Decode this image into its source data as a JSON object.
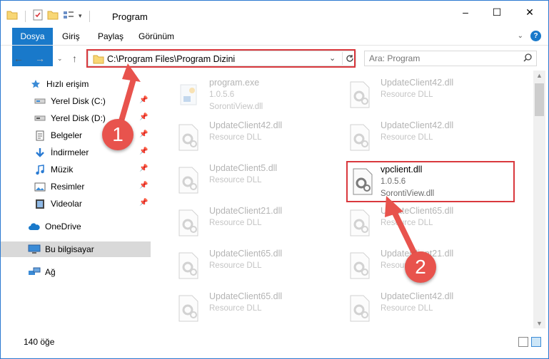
{
  "window": {
    "title": "Program",
    "controls": {
      "minimize": "–",
      "maximize": "☐",
      "close": "✕"
    }
  },
  "ribbon": {
    "tabs": [
      {
        "label": "Dosya"
      },
      {
        "label": "Giriş"
      },
      {
        "label": "Paylaş"
      },
      {
        "label": "Görünüm"
      }
    ],
    "help_icon": "?"
  },
  "address": {
    "path": "C:\\Program Files\\Program Dizini",
    "search_placeholder": "Ara: Program"
  },
  "nav": {
    "items": [
      {
        "label": "Hızlı erişim",
        "icon": "star-icon"
      },
      {
        "label": "Yerel Disk (C:)",
        "icon": "drive-icon",
        "pinned": true
      },
      {
        "label": "Yerel Disk (D:)",
        "icon": "drive-icon",
        "pinned": true
      },
      {
        "label": "Belgeler",
        "icon": "documents-icon",
        "pinned": true
      },
      {
        "label": "İndirmeler",
        "icon": "download-icon",
        "pinned": true
      },
      {
        "label": "Müzik",
        "icon": "music-icon",
        "pinned": true
      },
      {
        "label": "Resimler",
        "icon": "pictures-icon",
        "pinned": true
      },
      {
        "label": "Videolar",
        "icon": "videos-icon",
        "pinned": true
      },
      {
        "label": "OneDrive",
        "icon": "cloud-icon"
      },
      {
        "label": "Bu bilgisayar",
        "icon": "computer-icon",
        "selected": true
      },
      {
        "label": "Ağ",
        "icon": "network-icon"
      }
    ]
  },
  "files": [
    {
      "name": "program.exe",
      "l2": "1.0.5.6",
      "l3": "SorontiView.dll"
    },
    {
      "name": "UpdateClient42.dll",
      "l2": "Resource DLL",
      "l3": ""
    },
    {
      "name": "UpdateClient42.dll",
      "l2": "Resource DLL",
      "l3": ""
    },
    {
      "name": "UpdateClient42.dll",
      "l2": "Resource DLL",
      "l3": ""
    },
    {
      "name": "UpdateClient5.dll",
      "l2": "Resource DLL",
      "l3": ""
    },
    {
      "name": "vpclient.dll",
      "l2": "1.0.5.6",
      "l3": "SorontiView.dll"
    },
    {
      "name": "UpdateClient21.dll",
      "l2": "Resource DLL",
      "l3": ""
    },
    {
      "name": "UpdateClient65.dll",
      "l2": "Resource DLL",
      "l3": ""
    },
    {
      "name": "UpdateClient65.dll",
      "l2": "Resource DLL",
      "l3": ""
    },
    {
      "name": "UpdateClient21.dll",
      "l2": "Resource DLL",
      "l3": ""
    },
    {
      "name": "UpdateClient65.dll",
      "l2": "Resource DLL",
      "l3": ""
    },
    {
      "name": "UpdateClient42.dll",
      "l2": "Resource DLL",
      "l3": ""
    }
  ],
  "status": {
    "count": "140 öğe"
  },
  "annotations": {
    "step1": "1",
    "step2": "2",
    "accent": "#e8534d"
  }
}
